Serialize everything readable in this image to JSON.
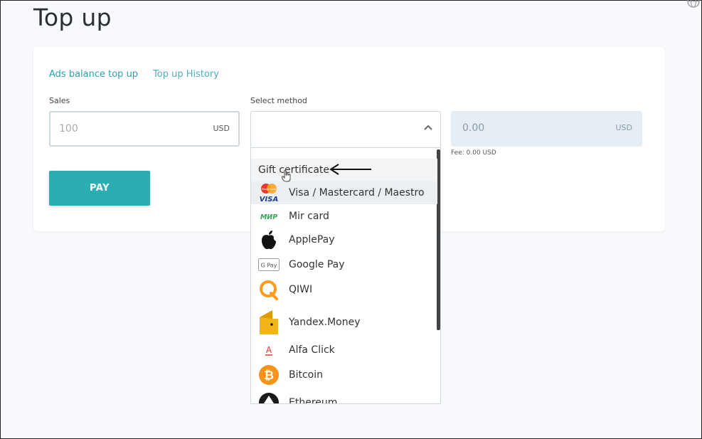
{
  "page": {
    "title": "Top up"
  },
  "tabs": [
    {
      "label": "Ads balance top up"
    },
    {
      "label": "Top up History"
    }
  ],
  "sales": {
    "label": "Sales",
    "placeholder": "100",
    "currency": "USD"
  },
  "method": {
    "label": "Select method"
  },
  "total": {
    "value": "0.00",
    "currency": "USD",
    "fee": "Fee: 0.00 USD"
  },
  "pay_button": {
    "label": "PAY"
  },
  "dropdown": {
    "options": [
      {
        "label": "Gift certificate",
        "icon": "none"
      },
      {
        "label": "Visa / Mastercard / Maestro",
        "icon": "visa-mastercard-icon"
      },
      {
        "label": "Mir card",
        "icon": "mir-icon"
      },
      {
        "label": "ApplePay",
        "icon": "apple-icon"
      },
      {
        "label": "Google Pay",
        "icon": "google-pay-icon"
      },
      {
        "label": "QIWI",
        "icon": "qiwi-icon"
      },
      {
        "label": "Yandex.Money",
        "icon": "yandex-money-icon"
      },
      {
        "label": "Alfa Click",
        "icon": "alfa-icon"
      },
      {
        "label": "Bitcoin",
        "icon": "bitcoin-icon"
      },
      {
        "label": "Ethereum",
        "icon": "ethereum-icon"
      }
    ],
    "icon_text": {
      "mastercard": "MasterCard",
      "visa": "VISA",
      "mir": "МИР",
      "gpay": "G Pay",
      "alfa": "A",
      "bitcoin": "₿"
    }
  },
  "colors": {
    "accent": "#2aaeb2",
    "link": "#25a5b0",
    "total_bg": "#e6eef5"
  }
}
